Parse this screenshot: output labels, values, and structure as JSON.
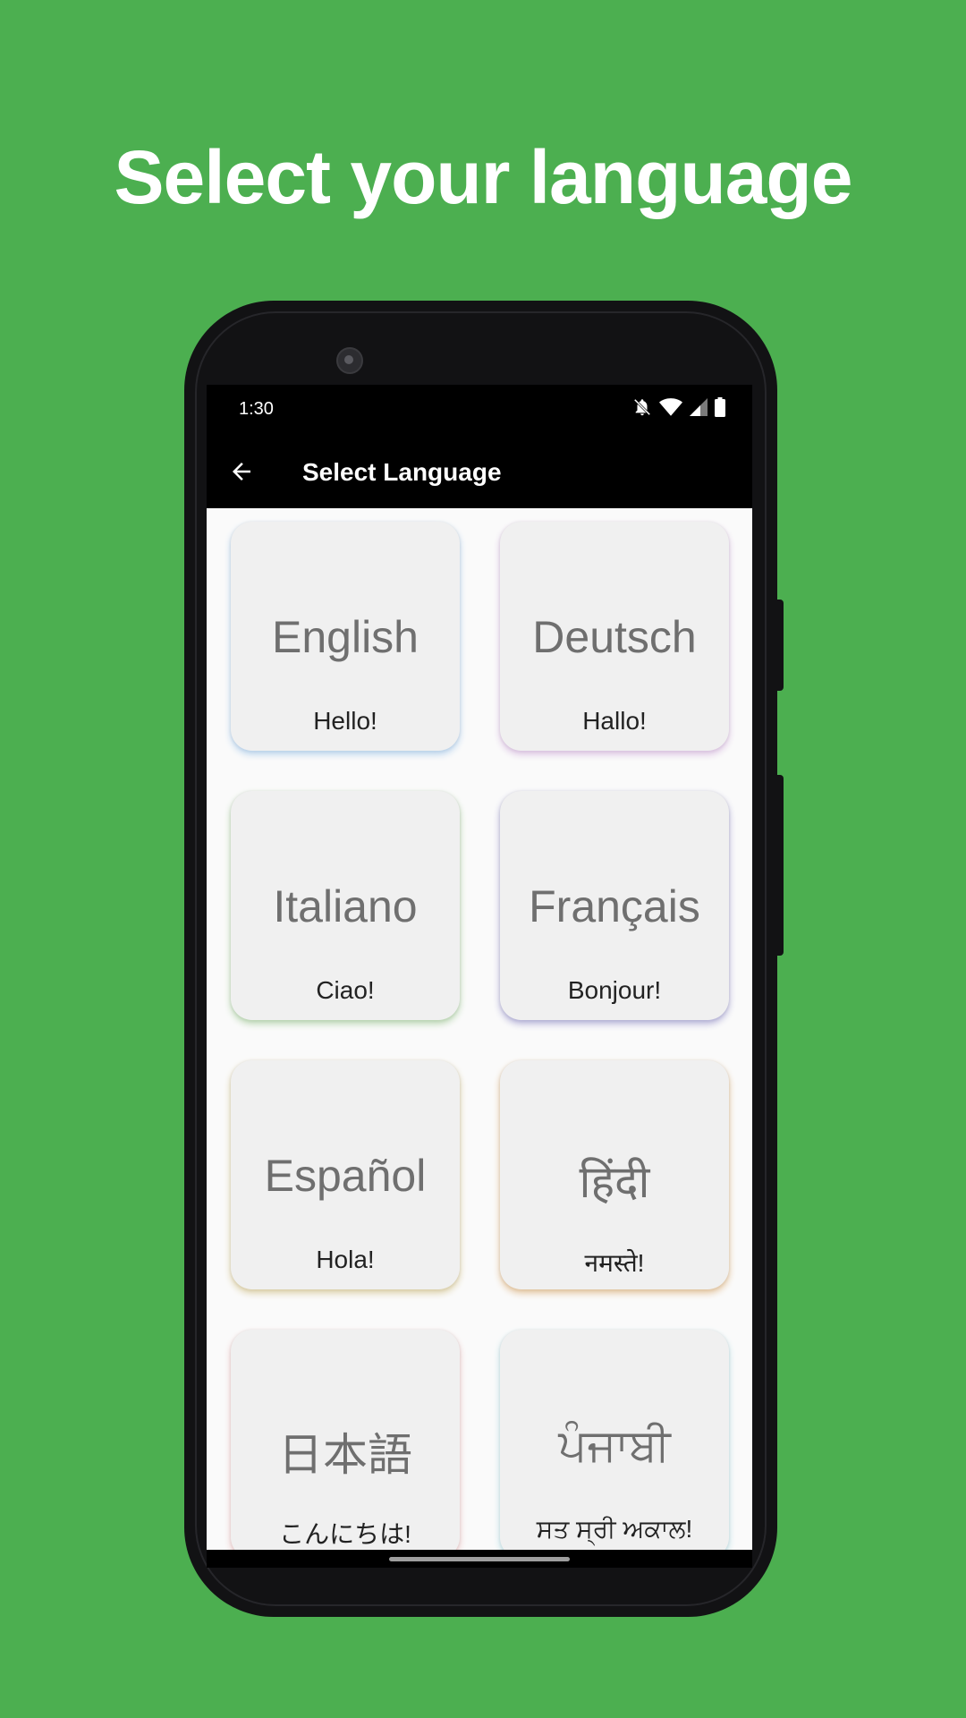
{
  "headline": "Select your language",
  "status": {
    "time": "1:30"
  },
  "appbar": {
    "title": "Select Language"
  },
  "languages": [
    {
      "name": "English",
      "greeting": "Hello!",
      "accent": "#b9d4ee"
    },
    {
      "name": "Deutsch",
      "greeting": "Hallo!",
      "accent": "#dcc3e3"
    },
    {
      "name": "Italiano",
      "greeting": "Ciao!",
      "accent": "#b8d6b0"
    },
    {
      "name": "Français",
      "greeting": "Bonjour!",
      "accent": "#b3b0d8"
    },
    {
      "name": "Español",
      "greeting": "Hola!",
      "accent": "#dccfa4"
    },
    {
      "name": "हिंदी",
      "greeting": "नमस्ते!",
      "accent": "#e4c39a"
    },
    {
      "name": "日本語",
      "greeting": "こんにちは!",
      "accent": "#eec7c7"
    },
    {
      "name": "ਪੰਜਾਬੀ",
      "greeting": "ਸਤ ਸ੍ਰੀ ਅਕਾਲ!",
      "accent": "#bfe2e8"
    }
  ]
}
